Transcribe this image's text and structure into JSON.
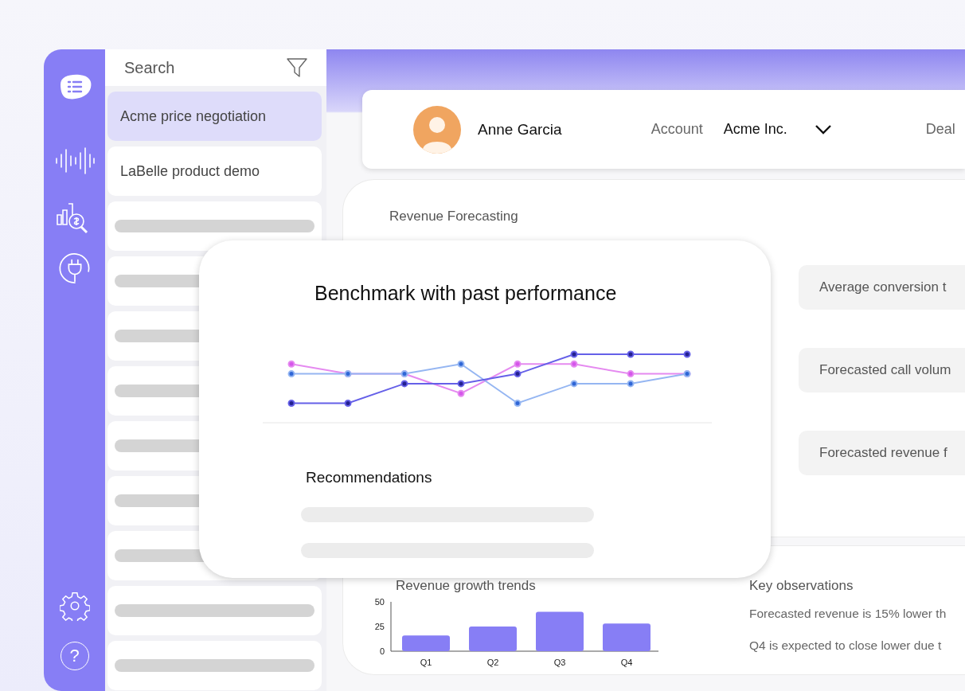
{
  "sidebar": {
    "help_glyph": "?"
  },
  "list": {
    "search": {
      "placeholder": "Search"
    },
    "items": [
      {
        "kind": "text",
        "label": "Acme price negotiation",
        "selected": true
      },
      {
        "kind": "text",
        "label": "LaBelle product demo",
        "selected": false
      },
      {
        "kind": "skeleton",
        "selected": false
      },
      {
        "kind": "skeleton",
        "selected": false
      },
      {
        "kind": "skeleton",
        "selected": false
      },
      {
        "kind": "skeleton",
        "selected": false
      },
      {
        "kind": "skeleton",
        "selected": false
      },
      {
        "kind": "skeleton",
        "selected": false
      },
      {
        "kind": "skeleton",
        "selected": false
      },
      {
        "kind": "skeleton",
        "selected": false
      },
      {
        "kind": "skeleton",
        "selected": false
      }
    ]
  },
  "header": {
    "name": "Anne Garcia",
    "account_label": "Account",
    "account_value": "Acme Inc.",
    "deal_label": "Deal"
  },
  "forecast": {
    "title": "Revenue Forecasting",
    "metrics": [
      "Average conversion t",
      "Forecasted call volum",
      "Forecasted revenue f"
    ]
  },
  "popup": {
    "title": "Benchmark with past performance",
    "recommendations_title": "Recommendations",
    "recommendation_lines": [
      {
        "kind": "skeleton"
      },
      {
        "kind": "skeleton"
      }
    ]
  },
  "growth": {
    "title": "Revenue growth trends",
    "chart_data": {
      "type": "bar",
      "categories": [
        "Q1",
        "Q2",
        "Q3",
        "Q4"
      ],
      "series": [
        {
          "color": "#877ef5",
          "values": [
            16,
            25,
            40,
            28
          ]
        }
      ],
      "ylim": [
        0,
        50
      ],
      "yticks": [
        0,
        25,
        50
      ]
    }
  },
  "observations": {
    "title": "Key observations",
    "items": [
      "Forecasted revenue is 15% lower th",
      "Q4 is expected to close lower due t"
    ]
  }
}
